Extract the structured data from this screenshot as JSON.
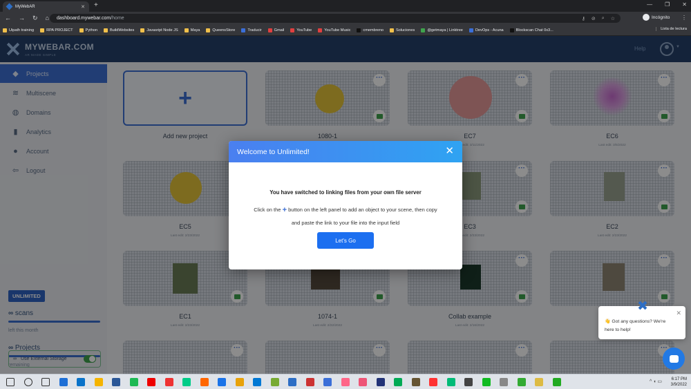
{
  "browser": {
    "tab_title": "MyWebAR",
    "tab_close": "✕",
    "new_tab": "+",
    "url_host": "dashboard.mywebar.com",
    "url_path": "/home",
    "incognito_label": "Incógnito",
    "reading_list": "Lista de lectura",
    "bookmarks": [
      {
        "label": "Uipath training",
        "icon": "folder-icon",
        "color": "#f0c04b"
      },
      {
        "label": "RPA PROJECT",
        "icon": "folder-icon",
        "color": "#f0c04b"
      },
      {
        "label": "Python",
        "icon": "folder-icon",
        "color": "#f0c04b"
      },
      {
        "label": "BuildWebsites",
        "icon": "folder-icon",
        "color": "#f0c04b"
      },
      {
        "label": "Javasript Node JS",
        "icon": "folder-icon",
        "color": "#f0c04b"
      },
      {
        "label": "Maya",
        "icon": "folder-icon",
        "color": "#f0c04b"
      },
      {
        "label": "QueensStore",
        "icon": "folder-icon",
        "color": "#f0c04b"
      },
      {
        "label": "Traducir",
        "icon": "translate-icon",
        "color": "#3b6fd8"
      },
      {
        "label": "Gmail",
        "icon": "gmail-icon",
        "color": "#e04040"
      },
      {
        "label": "YouTube",
        "icon": "youtube-icon",
        "color": "#e04040"
      },
      {
        "label": "YouTube Music",
        "icon": "youtube-music-icon",
        "color": "#e04040"
      },
      {
        "label": "cmembreno",
        "icon": "github-icon",
        "color": "#111111"
      },
      {
        "label": "Soluciones",
        "icon": "folder-icon",
        "color": "#f0c04b"
      },
      {
        "label": "@getmaya | Linktree",
        "icon": "linktree-icon",
        "color": "#3fa34d"
      },
      {
        "label": "DevOps - Acuna",
        "icon": "devops-icon",
        "color": "#3b6fd8"
      },
      {
        "label": "Blockscan Chat 0x3...",
        "icon": "blockscan-icon",
        "color": "#111111"
      }
    ]
  },
  "app": {
    "brand": "MYWEBAR.COM",
    "tagline": "AR MADE SIMPLE",
    "help": "Help",
    "sidebar": [
      {
        "label": "Projects",
        "icon": "cube-icon",
        "active": true
      },
      {
        "label": "Multiscene",
        "icon": "layers-icon",
        "active": false
      },
      {
        "label": "Domains",
        "icon": "globe-icon",
        "active": false
      },
      {
        "label": "Analytics",
        "icon": "chart-icon",
        "active": false
      },
      {
        "label": "Account",
        "icon": "user-icon",
        "active": false
      },
      {
        "label": "Logout",
        "icon": "logout-icon",
        "active": false
      }
    ],
    "plan_badge": "UNLIMITED",
    "scans_label": "scans",
    "scans_sub": "left this month",
    "projects_label": "Projects",
    "projects_sub": "remaining",
    "infinity": "∞",
    "external_storage": "Use External Storage",
    "external_storage_on": true,
    "add_new_project": "Add new project",
    "projects": [
      {
        "title": "1080-1",
        "date": ""
      },
      {
        "title": "EC7",
        "date": "Last edit: 3/11/2022"
      },
      {
        "title": "EC6",
        "date": "Last edit: 3/5/2022"
      },
      {
        "title": "EC5",
        "date": "Last edit: 2/23/2022"
      },
      {
        "title": "",
        "date": ""
      },
      {
        "title": "EC3",
        "date": "Last edit: 2/23/2022"
      },
      {
        "title": "EC2",
        "date": "Last edit: 2/23/2022"
      },
      {
        "title": "EC1",
        "date": "Last edit: 2/23/2022"
      },
      {
        "title": "1074-1",
        "date": "Last edit: 2/22/2022"
      },
      {
        "title": "Collab example",
        "date": "Last edit: 2/16/2022"
      },
      {
        "title": "",
        "date": ""
      }
    ]
  },
  "modal": {
    "title": "Welcome to Unlimited!",
    "close": "✕",
    "heading": "You have switched to linking files from your own file server",
    "line1_pre": "Click on the",
    "line1_plus": "+",
    "line1_post": "button on the left panel to add an object to your scene, then copy",
    "line2": "and paste the link to your file into the input field",
    "button": "Let's Go"
  },
  "chat": {
    "message": "👋 Got any questions? We're here to help!",
    "close": "✕"
  },
  "taskbar": {
    "time": "6:17 PM",
    "date": "3/9/2022"
  }
}
